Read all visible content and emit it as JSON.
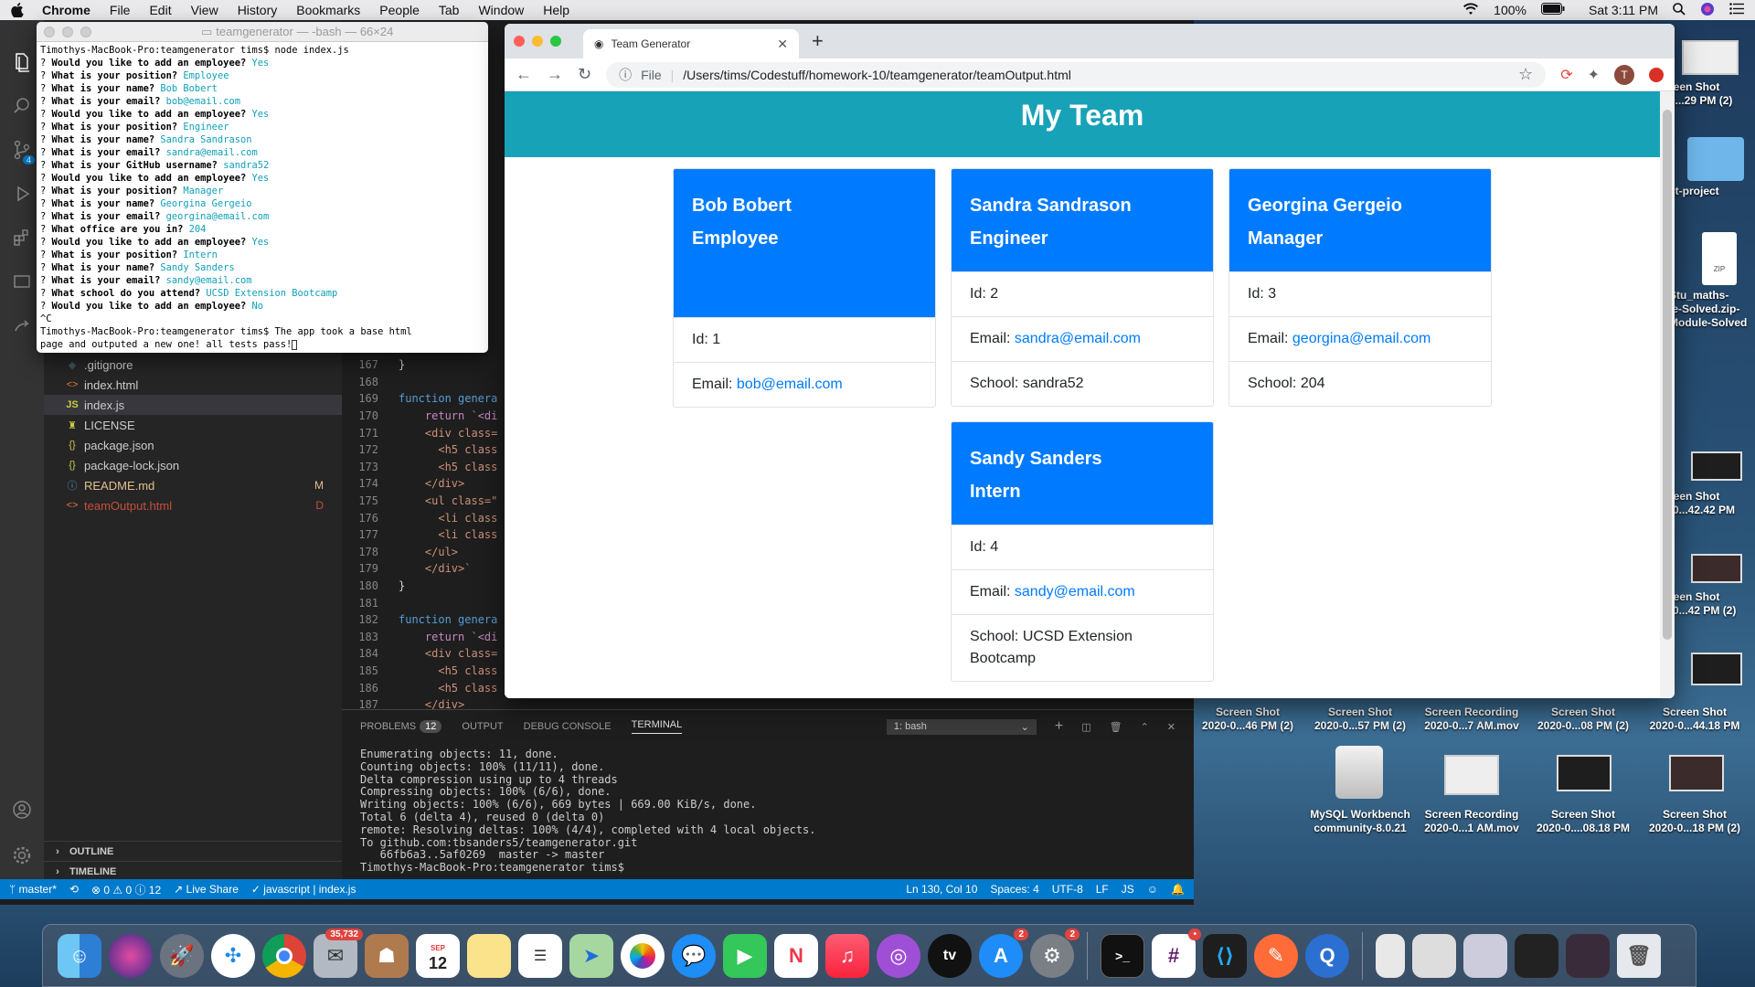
{
  "menubar": {
    "app": "Chrome",
    "menus": [
      "File",
      "Edit",
      "View",
      "History",
      "Bookmarks",
      "People",
      "Tab",
      "Window",
      "Help"
    ],
    "battery": "100%",
    "clock": "Sat 3:11 PM"
  },
  "terminal": {
    "title": "teamgenerator — -bash — 66×24",
    "lines": [
      {
        "p": "",
        "q": "Timothys-MacBook-Pro:teamgenerator tims$ node index.js",
        "a": ""
      },
      {
        "p": "? ",
        "q": "Would you like to add an employee? ",
        "a": "Yes"
      },
      {
        "p": "? ",
        "q": "What is your position? ",
        "a": "Employee"
      },
      {
        "p": "? ",
        "q": "What is your name? ",
        "a": "Bob Bobert"
      },
      {
        "p": "? ",
        "q": "What is your email? ",
        "a": "bob@email.com"
      },
      {
        "p": "? ",
        "q": "Would you like to add an employee? ",
        "a": "Yes"
      },
      {
        "p": "? ",
        "q": "What is your position? ",
        "a": "Engineer"
      },
      {
        "p": "? ",
        "q": "What is your name? ",
        "a": "Sandra Sandrason"
      },
      {
        "p": "? ",
        "q": "What is your email? ",
        "a": "sandra@email.com"
      },
      {
        "p": "? ",
        "q": "What is your GitHub username? ",
        "a": "sandra52"
      },
      {
        "p": "? ",
        "q": "Would you like to add an employee? ",
        "a": "Yes"
      },
      {
        "p": "? ",
        "q": "What is your position? ",
        "a": "Manager"
      },
      {
        "p": "? ",
        "q": "What is your name? ",
        "a": "Georgina Gergeio"
      },
      {
        "p": "? ",
        "q": "What is your email? ",
        "a": "georgina@email.com"
      },
      {
        "p": "? ",
        "q": "What office are you in? ",
        "a": "204"
      },
      {
        "p": "? ",
        "q": "Would you like to add an employee? ",
        "a": "Yes"
      },
      {
        "p": "? ",
        "q": "What is your position? ",
        "a": "Intern"
      },
      {
        "p": "? ",
        "q": "What is your name? ",
        "a": "Sandy Sanders"
      },
      {
        "p": "? ",
        "q": "What is your email? ",
        "a": "sandy@email.com"
      },
      {
        "p": "? ",
        "q": "What school do you attend? ",
        "a": "UCSD Extension Bootcamp"
      },
      {
        "p": "? ",
        "q": "Would you like to add an employee? ",
        "a": "No"
      },
      {
        "p": "",
        "q": "^C",
        "a": ""
      },
      {
        "p": "",
        "q": "Timothys-MacBook-Pro:teamgenerator tims$ The app took a base html",
        "a": ""
      },
      {
        "p": "",
        "q": "page and outputed a new one! all tests pass!",
        "a": ""
      }
    ]
  },
  "vscode": {
    "files": [
      {
        "name": ".gitignore",
        "icon": "git-icon",
        "status": "",
        "color": "#cccccc"
      },
      {
        "name": "index.html",
        "icon": "html-icon",
        "status": "",
        "color": "#cccccc"
      },
      {
        "name": "index.js",
        "icon": "js-icon",
        "status": "",
        "color": "#cccccc"
      },
      {
        "name": "LICENSE",
        "icon": "license-icon",
        "status": "",
        "color": "#cccccc"
      },
      {
        "name": "package.json",
        "icon": "json-icon",
        "status": "",
        "color": "#cccccc"
      },
      {
        "name": "package-lock.json",
        "icon": "json-icon",
        "status": "",
        "color": "#cccccc"
      },
      {
        "name": "README.md",
        "icon": "info-icon",
        "status": "M",
        "color": "#e2c08d"
      },
      {
        "name": "teamOutput.html",
        "icon": "html-icon",
        "status": "D",
        "color": "#c74e39"
      }
    ],
    "outline": "OUTLINE",
    "timeline": "TIMELINE",
    "code": [
      {
        "n": "167",
        "t": "}"
      },
      {
        "n": "168",
        "t": ""
      },
      {
        "n": "169",
        "t": "function genera"
      },
      {
        "n": "170",
        "t": "    return `<di"
      },
      {
        "n": "171",
        "t": "    <div class="
      },
      {
        "n": "172",
        "t": "      <h5 class"
      },
      {
        "n": "173",
        "t": "      <h5 class"
      },
      {
        "n": "174",
        "t": "    </div>"
      },
      {
        "n": "175",
        "t": "    <ul class=\""
      },
      {
        "n": "176",
        "t": "      <li class"
      },
      {
        "n": "177",
        "t": "      <li class"
      },
      {
        "n": "178",
        "t": "    </ul>"
      },
      {
        "n": "179",
        "t": "    </div>`"
      },
      {
        "n": "180",
        "t": "}"
      },
      {
        "n": "181",
        "t": ""
      },
      {
        "n": "182",
        "t": "function genera"
      },
      {
        "n": "183",
        "t": "    return `<di"
      },
      {
        "n": "184",
        "t": "    <div class="
      },
      {
        "n": "185",
        "t": "      <h5 class"
      },
      {
        "n": "186",
        "t": "      <h5 class"
      },
      {
        "n": "187",
        "t": "    </div>"
      }
    ],
    "panel": {
      "tabs": [
        "PROBLEMS",
        "OUTPUT",
        "DEBUG CONSOLE",
        "TERMINAL"
      ],
      "problems_count": "12",
      "shell": "1: bash",
      "output": "Enumerating objects: 11, done.\nCounting objects: 100% (11/11), done.\nDelta compression using up to 4 threads\nCompressing objects: 100% (6/6), done.\nWriting objects: 100% (6/6), 669 bytes | 669.00 KiB/s, done.\nTotal 6 (delta 4), reused 0 (delta 0)\nremote: Resolving deltas: 100% (4/4), completed with 4 local objects.\nTo github.com:tbsanders5/teamgenerator.git\n   66fb6a3..5af0269  master -> master\nTimothys-MacBook-Pro:teamgenerator tims$ "
    },
    "status": {
      "branch": "master*",
      "problems": "⊗ 0 ⚠ 0 ⓘ 12",
      "liveshare": "Live Share",
      "lang_check": "javascript | index.js",
      "position": "Ln 130, Col 10",
      "spaces": "Spaces: 4",
      "encoding": "UTF-8",
      "eol": "LF",
      "mode": "JS"
    }
  },
  "chrome": {
    "tab_title": "Team Generator",
    "url_prefix": "File",
    "url": "/Users/tims/Codestuff/homework-10/teamgenerator/teamOutput.html",
    "profile_initial": "T"
  },
  "page": {
    "heading": "My Team",
    "cards": [
      {
        "name": "Bob Bobert",
        "role": "Employee",
        "id": "Id: 1",
        "email_label": "Email: ",
        "email": "bob@email.com",
        "extra": ""
      },
      {
        "name": "Sandra Sandrason",
        "role": "Engineer",
        "id": "Id: 2",
        "email_label": "Email: ",
        "email": "sandra@email.com",
        "extra": "School: sandra52"
      },
      {
        "name": "Georgina Gergeio",
        "role": "Manager",
        "id": "Id: 3",
        "email_label": "Email: ",
        "email": "georgina@email.com",
        "extra": "School: 204"
      },
      {
        "name": "Sandy Sanders",
        "role": "Intern",
        "id": "Id: 4",
        "email_label": "Email: ",
        "email": "sandy@email.com",
        "extra": "School: UCSD Extension Bootcamp"
      }
    ]
  },
  "desktop": {
    "icons": [
      {
        "label": "Screen Shot\n2020-0...46 PM (2)"
      },
      {
        "label": "Screen Shot\n2020-0...57 PM (2)"
      },
      {
        "label": "Screen Recording\n2020-0...7 AM.mov"
      },
      {
        "label": "Screen Shot\n2020-0...08 PM (2)"
      },
      {
        "label": "Screen Shot\n2020-0...44.18 PM"
      },
      {
        "label": "MySQL Workbench\ncommunity-8.0.21"
      },
      {
        "label": "Screen Recording\n2020-0...1 AM.mov"
      },
      {
        "label": "Screen Shot\n2020-0....08.18 PM"
      },
      {
        "label": "Screen Shot\n2020-0...18 PM (2)"
      }
    ],
    "edge_labels": [
      "reen Shot\n0...29 PM (2)",
      "st-project",
      "Stu_maths-\nle-Solved.zip-\nModule-Solved",
      "reen Shot\n-0...42.42 PM",
      "reen Shot\n-0...42 PM (2)"
    ]
  },
  "dock": {
    "mail_badge": "35,732",
    "calendar_month": "SEP",
    "calendar_day": "12",
    "appstore_badge": "2",
    "prefs_badge": "2",
    "apps": [
      "Finder",
      "Siri",
      "Launchpad",
      "Safari",
      "Chrome",
      "Mail",
      "Contacts",
      "Calendar",
      "Notes",
      "Reminders",
      "Maps",
      "Photos",
      "Messages",
      "FaceTime",
      "News",
      "Music",
      "Podcasts",
      "TV",
      "App Store",
      "System Preferences",
      "Terminal",
      "Slack",
      "VS Code",
      "Postman",
      "QuickTime",
      "Trash"
    ]
  }
}
